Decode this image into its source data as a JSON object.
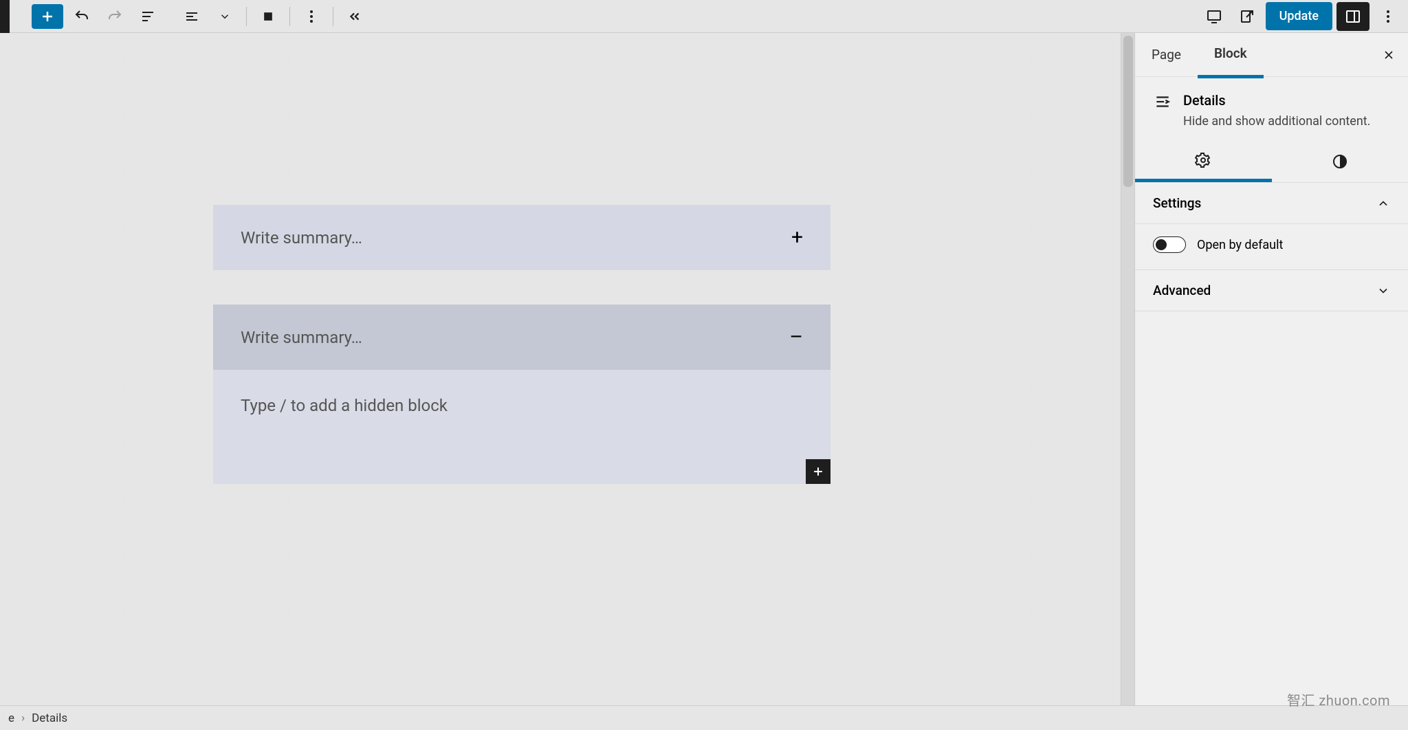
{
  "toolbar": {
    "update_label": "Update"
  },
  "blocks": {
    "summary1_placeholder": "Write summary…",
    "summary2_placeholder": "Write summary…",
    "hidden_placeholder": "Type / to add a hidden block",
    "symbol_plus": "+",
    "symbol_minus": "–"
  },
  "sidebar": {
    "tab_page": "Page",
    "tab_block": "Block",
    "block_title": "Details",
    "block_desc": "Hide and show additional content.",
    "section_settings": "Settings",
    "toggle_open_label": "Open by default",
    "section_advanced": "Advanced"
  },
  "breadcrumb": {
    "parent_fragment": "e",
    "current": "Details"
  },
  "watermark": "智汇 zhuon.com"
}
